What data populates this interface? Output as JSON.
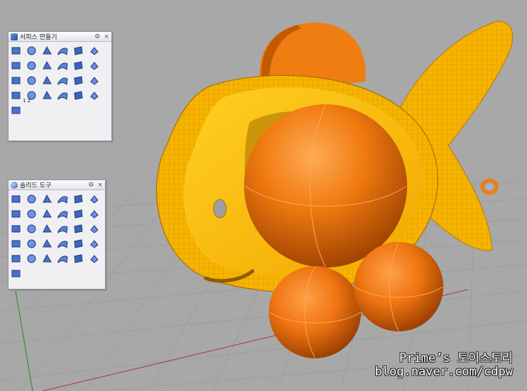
{
  "colors": {
    "viewport_bg": "#a9a9a9",
    "grid_line": "#9a9a9a",
    "x_axis": "#b24a4a",
    "y_axis": "#3c8a3c",
    "fish_body": "#ffbb00",
    "fish_wire": "#c98a00",
    "sphere": "#f07a10",
    "sphere_dark": "#a54400"
  },
  "panel_surface": {
    "title": "서피스 만들기",
    "title_icon": "surface-app-icon",
    "settings_icon": "gear-icon",
    "close_icon": "close-icon",
    "tool_icons": [
      "corner-points-icon",
      "edge-curves-icon",
      "planar-curves-icon",
      "patch-icon",
      "loft-icon",
      "extrude-icon",
      "sweep1-icon",
      "sweep2-icon",
      "rail-revolve-icon",
      "blend-icon",
      "network-icon",
      "heightfield-icon",
      "revolve-icon",
      "loft-twist-icon",
      "sheet-icon",
      "cone-icon",
      "offset-icon",
      "pipe-icon",
      "rail-1-2-icon",
      "arc-surface-icon",
      "pinch-icon",
      "pyramid-icon",
      "plane-icon",
      "mesh-grid-icon",
      "sweep-blade-icon"
    ],
    "tool_sublabel": "1 2"
  },
  "panel_solid": {
    "title": "솔리드 도구",
    "title_icon": "solid-app-icon",
    "settings_icon": "gear-icon",
    "close_icon": "close-icon",
    "tool_icons": [
      "union-icon",
      "difference-icon",
      "intersect-icon",
      "split-icon",
      "box-edge-icon",
      "merge-icon",
      "fillet-edge-icon",
      "shell-icon",
      "cap-icon",
      "explode-icon",
      "extrude-face-icon",
      "cube-icon",
      "offset-face-icon",
      "bend-icon",
      "move-face-icon",
      "push-pull-icon",
      "split-face-icon",
      "move-edge-icon",
      "chamfer-icon",
      "cut-icon",
      "shear-icon",
      "rotate-face-icon",
      "hole-icon",
      "solid-edit-icon",
      "wall-icon",
      "column-icon",
      "mortar-icon",
      "pattern-icon",
      "array-icon",
      "remove-icon",
      "connect-icon"
    ]
  },
  "watermark": {
    "line1": "Prime’s 토이스토리",
    "line2": "blog.naver.com/cdpw"
  }
}
